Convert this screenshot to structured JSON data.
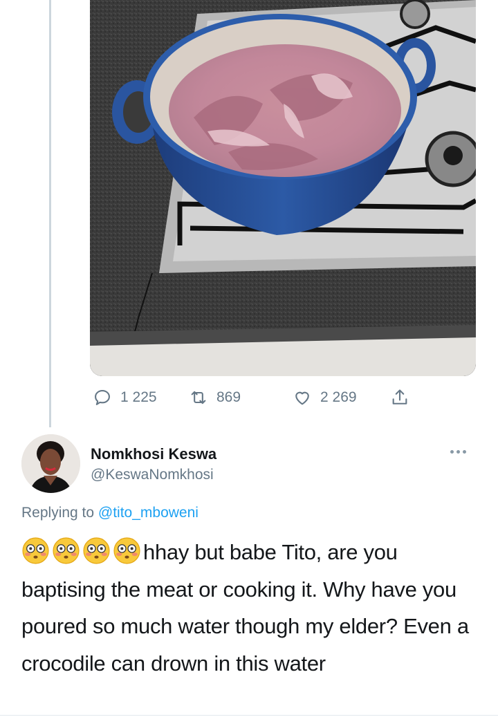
{
  "quoted_tweet": {
    "photo_description_icon": "cooking-pot-photo",
    "stats": {
      "replies": "1 225",
      "retweets": "869",
      "likes": "2 269"
    }
  },
  "reply": {
    "author_name": "Nomkhosi Keswa",
    "author_handle": "@KeswaNomkhosi",
    "replying_label": "Replying to",
    "replying_to": "@tito_mboweni",
    "emoji": [
      "flushed-face",
      "flushed-face",
      "flushed-face",
      "flushed-face"
    ],
    "text": "hhay but babe Tito, are you baptising the meat or cooking it. Why have you poured so much water though my elder? Even a crocodile can drown in this water"
  },
  "colors": {
    "accent": "#1da1f2",
    "secondary_text": "#657786",
    "thread_line": "#ccd6dd"
  }
}
